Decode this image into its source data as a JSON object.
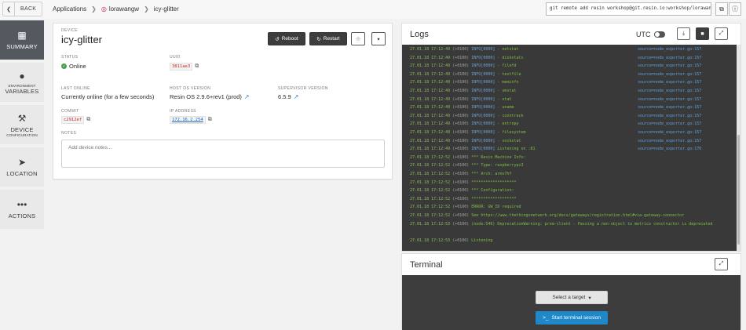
{
  "topbar": {
    "back_label": "BACK",
    "breadcrumbs": [
      "Applications",
      "lorawangw",
      "icy-glitter"
    ],
    "git_command": "git remote add resin workshop@git.resin.io:workshop/lorawangw"
  },
  "sidebar": {
    "items": [
      {
        "label": "SUMMARY",
        "sub": "",
        "icon": "grid-icon",
        "active": true
      },
      {
        "label": "VARIABLES",
        "sub": "ENVIRONMENT",
        "icon": "globe-icon",
        "active": false
      },
      {
        "label": "DEVICE",
        "sub": "CONFIGURATION",
        "icon": "wrench-icon",
        "active": false
      },
      {
        "label": "LOCATION",
        "sub": "",
        "icon": "location-arrow-icon",
        "active": false
      },
      {
        "label": "ACTIONS",
        "sub": "",
        "icon": "dots-icon",
        "active": false
      }
    ]
  },
  "device": {
    "section_label": "DEVICE",
    "name": "icy-glitter",
    "reboot_label": "Reboot",
    "restart_label": "Restart",
    "status_label": "STATUS",
    "status_value": "Online",
    "uuid_label": "UUID",
    "uuid_value": "3811ae3",
    "last_online_label": "LAST ONLINE",
    "last_online_value": "Currently online (for a few seconds)",
    "host_os_label": "HOST OS VERSION",
    "host_os_value": "Resin OS 2.9.6+rev1 (prod)",
    "supervisor_label": "SUPERVISOR VERSION",
    "supervisor_value": "6.5.9",
    "commit_label": "COMMIT",
    "commit_value": "c2912ef",
    "ip_label": "IP ADDRESS",
    "ip_value": "172.16.2.254",
    "notes_label": "NOTES",
    "notes_placeholder": "Add device notes...",
    "colors": {
      "online": "#43a047",
      "accent": "#c62828"
    }
  },
  "logs": {
    "title": "Logs",
    "utc_label": "UTC",
    "lines": [
      {
        "ts": "27.01.18 17:12:49",
        "tz": "(+0100)",
        "lvl": "INFO[0000]",
        "msg": " - netstat",
        "src": "source=node_exporter.go:157"
      },
      {
        "ts": "27.01.18 17:12:49",
        "tz": "(+0100)",
        "lvl": "INFO[0000]",
        "msg": " - diskstats",
        "src": "source=node_exporter.go:157"
      },
      {
        "ts": "27.01.18 17:12:49",
        "tz": "(+0100)",
        "lvl": "INFO[0000]",
        "msg": " - filefd",
        "src": "source=node_exporter.go:157"
      },
      {
        "ts": "27.01.18 17:12:49",
        "tz": "(+0100)",
        "lvl": "INFO[0000]",
        "msg": " - textfile",
        "src": "source=node_exporter.go:157"
      },
      {
        "ts": "27.01.18 17:12:49",
        "tz": "(+0100)",
        "lvl": "INFO[0000]",
        "msg": " - meminfo",
        "src": "source=node_exporter.go:157"
      },
      {
        "ts": "27.01.18 17:12:49",
        "tz": "(+0100)",
        "lvl": "INFO[0000]",
        "msg": " - vmstat",
        "src": "source=node_exporter.go:157"
      },
      {
        "ts": "27.01.18 17:12:49",
        "tz": "(+0100)",
        "lvl": "INFO[0000]",
        "msg": " - stat",
        "src": "source=node_exporter.go:157"
      },
      {
        "ts": "27.01.18 17:12:49",
        "tz": "(+0100)",
        "lvl": "INFO[0000]",
        "msg": " - uname",
        "src": "source=node_exporter.go:157"
      },
      {
        "ts": "27.01.18 17:12:49",
        "tz": "(+0100)",
        "lvl": "INFO[0000]",
        "msg": " - conntrack",
        "src": "source=node_exporter.go:157"
      },
      {
        "ts": "27.01.18 17:12:49",
        "tz": "(+0100)",
        "lvl": "INFO[0000]",
        "msg": " - entropy",
        "src": "source=node_exporter.go:157"
      },
      {
        "ts": "27.01.18 17:12:49",
        "tz": "(+0100)",
        "lvl": "INFO[0000]",
        "msg": " - filesystem",
        "src": "source=node_exporter.go:157"
      },
      {
        "ts": "27.01.18 17:12:49",
        "tz": "(+0100)",
        "lvl": "INFO[0000]",
        "msg": " - sockstat",
        "src": "source=node_exporter.go:157"
      },
      {
        "ts": "27.01.18 17:12:49",
        "tz": "(+0100)",
        "lvl": "INFO[0000]",
        "msg": " Listening on :81",
        "src": "source=node_exporter.go:176"
      },
      {
        "ts": "27.01.18 17:12:52",
        "tz": "(+0100)",
        "lvl": "",
        "msg": "*** Resin Machine Info:",
        "src": ""
      },
      {
        "ts": "27.01.18 17:12:52",
        "tz": "(+0100)",
        "lvl": "",
        "msg": "*** Type: raspberrypi3",
        "src": ""
      },
      {
        "ts": "27.01.18 17:12:52",
        "tz": "(+0100)",
        "lvl": "",
        "msg": "*** Arch: armv7hf",
        "src": ""
      },
      {
        "ts": "27.01.18 17:12:52",
        "tz": "(+0100)",
        "lvl": "",
        "msg": "*******************",
        "src": ""
      },
      {
        "ts": "27.01.18 17:12:52",
        "tz": "(+0100)",
        "lvl": "",
        "msg": "*** Configuration:",
        "src": ""
      },
      {
        "ts": "27.01.18 17:12:52",
        "tz": "(+0100)",
        "lvl": "",
        "msg": "*******************",
        "src": ""
      },
      {
        "ts": "27.01.18 17:12:52",
        "tz": "(+0100)",
        "lvl": "",
        "msg": "ERROR: GW_ID required",
        "src": ""
      },
      {
        "ts": "27.01.18 17:12:52",
        "tz": "(+0100)",
        "lvl": "",
        "msg": "See https://www.thethingsnetwork.org/docs/gateways/registration.html#via-gateway-connector",
        "src": ""
      },
      {
        "ts": "27.01.18 17:12:53",
        "tz": "(+0100)",
        "lvl": "",
        "msg": "(node:546) DeprecationWarning: prom-client - Passing a non-object to metrics constructor is deprecated",
        "src": ""
      },
      {
        "ts": "27.01.18 17:12:53",
        "tz": "(+0100)",
        "lvl": "",
        "msg": "Listening",
        "src": ""
      }
    ]
  },
  "terminal": {
    "title": "Terminal",
    "select_label": "Select a target",
    "start_label": "Start terminal session"
  }
}
